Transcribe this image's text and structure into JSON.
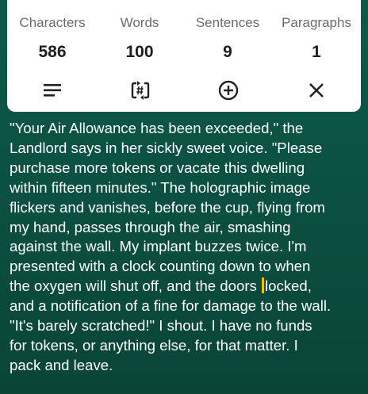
{
  "stats": {
    "characters": {
      "label": "Characters",
      "value": "586"
    },
    "words": {
      "label": "Words",
      "value": "100"
    },
    "sentences": {
      "label": "Sentences",
      "value": "9"
    },
    "paragraphs": {
      "label": "Paragraphs",
      "value": "1"
    }
  },
  "toolbar": {
    "icons": [
      "menu-lines-icon",
      "hashtag-cycle-icon",
      "plus-circle-icon",
      "close-icon"
    ]
  },
  "text": {
    "lines": [
      "\"Your Air Allowance has been exceeded,\" the",
      "Landlord says in her sickly sweet voice. \"Please",
      "purchase more tokens or vacate this dwelling",
      "within fifteen minutes.\" The holographic image",
      "flickers and vanishes, before the cup, flying from",
      "my hand, passes through the air, smashing",
      "against the wall. My implant buzzes twice. I'm",
      "presented with a clock counting down to when",
      "the oxygen will shut off, and the doors ",
      "locked,",
      "and a notification of a fine for damage to the wall.",
      "\"It's barely scratched!\" I shout. I have no funds",
      "for tokens, or anything else, for that matter. I",
      "pack and leave."
    ]
  },
  "colors": {
    "background": "#0b4f41",
    "card": "#ffffff",
    "cursor": "#f2c200"
  }
}
